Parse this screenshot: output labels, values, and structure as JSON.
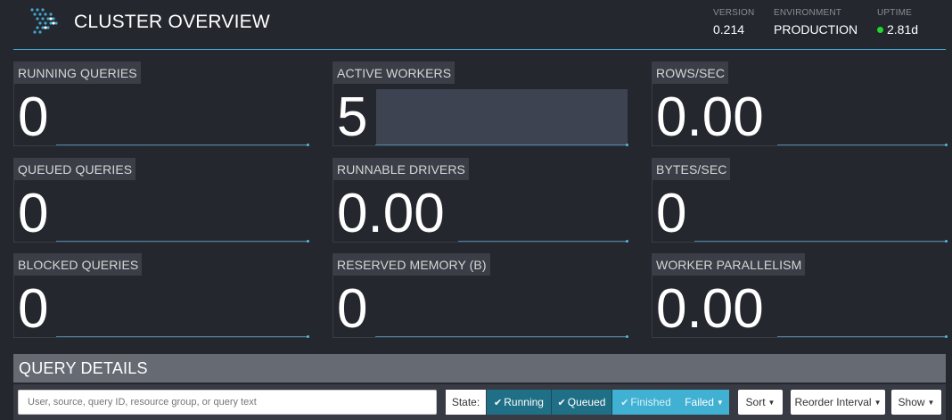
{
  "header": {
    "title": "CLUSTER OVERVIEW",
    "stats": {
      "version": {
        "label": "VERSION",
        "value": "0.214"
      },
      "environment": {
        "label": "ENVIRONMENT",
        "value": "PRODUCTION"
      },
      "uptime": {
        "label": "UPTIME",
        "value": "2.81d",
        "status_color": "#1ed82b"
      }
    }
  },
  "tiles": {
    "running_queries": {
      "label": "RUNNING QUERIES",
      "value": "0"
    },
    "active_workers": {
      "label": "ACTIVE WORKERS",
      "value": "5"
    },
    "rows_sec": {
      "label": "ROWS/SEC",
      "value": "0.00"
    },
    "queued_queries": {
      "label": "QUEUED QUERIES",
      "value": "0"
    },
    "runnable_drivers": {
      "label": "RUNNABLE DRIVERS",
      "value": "0.00"
    },
    "bytes_sec": {
      "label": "BYTES/SEC",
      "value": "0"
    },
    "blocked_queries": {
      "label": "BLOCKED QUERIES",
      "value": "0"
    },
    "reserved_memory": {
      "label": "RESERVED MEMORY (B)",
      "value": "0"
    },
    "worker_parallelism": {
      "label": "WORKER PARALLELISM",
      "value": "0.00"
    }
  },
  "query_details": {
    "title": "QUERY DETAILS",
    "search_placeholder": "User, source, query ID, resource group, or query text",
    "state_label": "State:",
    "filters": {
      "running": "Running",
      "queued": "Queued",
      "finished": "Finished",
      "failed": "Failed"
    },
    "sort_label": "Sort",
    "reorder_label": "Reorder Interval",
    "show_label": "Show"
  },
  "icons": {
    "check": "checkmark-icon",
    "caret": "caret-down-icon",
    "logo": "presto-logo-icon"
  },
  "colors": {
    "accent": "#3fa6cc",
    "filter_active": "#1f6f86",
    "filter_light": "#40b1d2"
  }
}
